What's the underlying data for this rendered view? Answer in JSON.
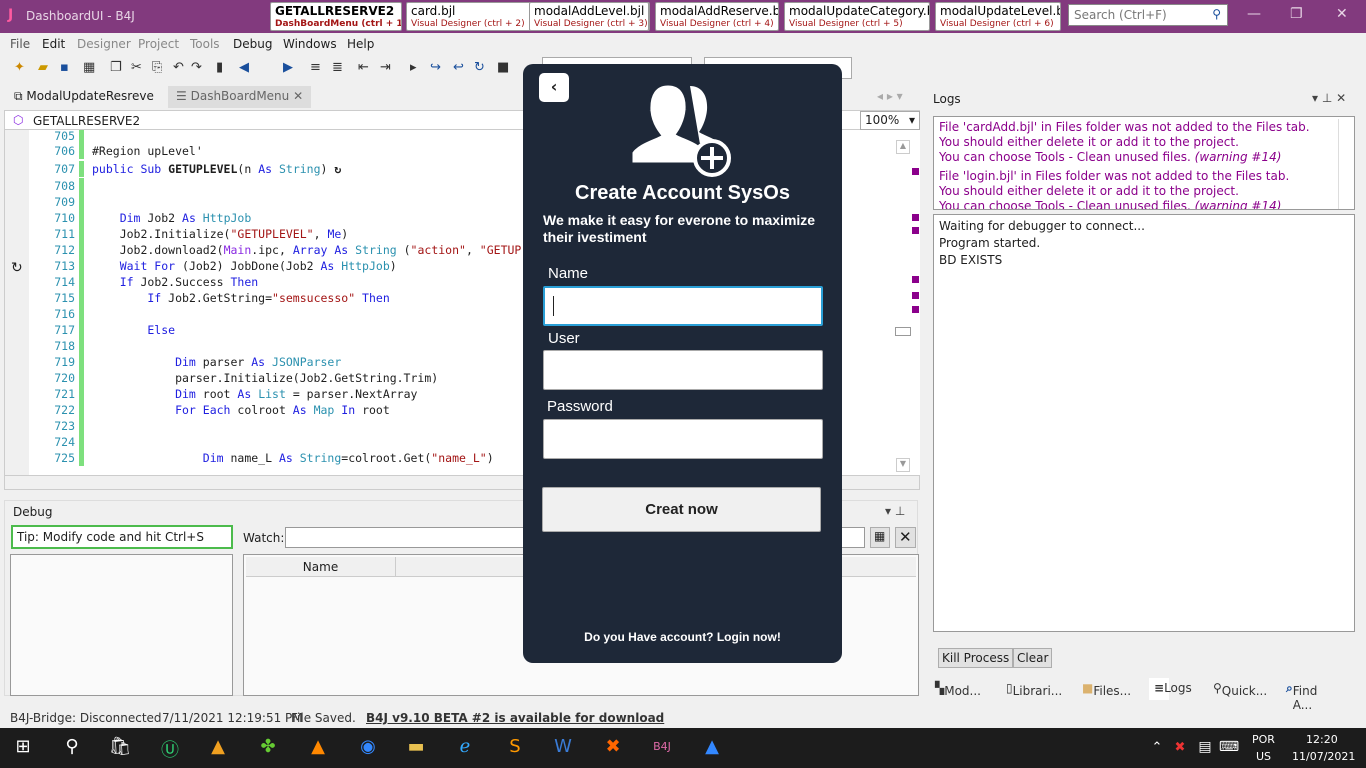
{
  "window": {
    "logo": "J",
    "title": "DashboardUI - B4J",
    "minimize": "—",
    "maximize": "❐",
    "close": "✕"
  },
  "file_tabs": [
    {
      "name": "GETALLRESERVE2",
      "sub": "DashBoardMenu  (ctrl + 1)"
    },
    {
      "name": "card.bjl",
      "sub": "Visual Designer  (ctrl + 2)"
    },
    {
      "name": "modalAddLevel.bjl",
      "sub": "Visual Designer  (ctrl + 3)"
    },
    {
      "name": "modalAddReserve.bjl",
      "sub": "Visual Designer  (ctrl + 4)"
    },
    {
      "name": "modalUpdateCategory.bjl",
      "sub": "Visual Designer  (ctrl + 5)"
    },
    {
      "name": "modalUpdateLevel.bjl",
      "sub": "Visual Designer  (ctrl + 6)"
    }
  ],
  "search": {
    "placeholder": "Search (Ctrl+F)",
    "icon": "search-icon"
  },
  "menu": [
    "File",
    "Edit",
    "Designer",
    "Project",
    "Tools",
    "Debug",
    "Windows",
    "Help"
  ],
  "doc_tabs": [
    "ModalUpdateResreve",
    "DashBoardMenu"
  ],
  "code_header": {
    "sub": "GETALLRESERVE2",
    "zoom": "100%"
  },
  "code_lines": [
    {
      "num": "705",
      "tokens": []
    },
    {
      "num": "706",
      "tokens": [
        {
          "t": "#Region upLevel'",
          "c": ""
        }
      ]
    },
    {
      "num": "707",
      "tokens": [
        {
          "t": "public Sub ",
          "c": "k"
        },
        {
          "t": "GETUPLEVEL",
          "c": "b"
        },
        {
          "t": "(n ",
          "c": ""
        },
        {
          "t": "As ",
          "c": "k"
        },
        {
          "t": "String",
          "c": "t"
        },
        {
          "t": ")",
          "c": ""
        }
      ]
    },
    {
      "num": "708",
      "tokens": []
    },
    {
      "num": "709",
      "tokens": []
    },
    {
      "num": "710",
      "tokens": [
        {
          "t": "    Dim ",
          "c": "k"
        },
        {
          "t": "Job2 ",
          "c": ""
        },
        {
          "t": "As ",
          "c": "k"
        },
        {
          "t": "HttpJob",
          "c": "t"
        }
      ]
    },
    {
      "num": "711",
      "tokens": [
        {
          "t": "    Job2.Initialize(",
          "c": ""
        },
        {
          "t": "\"GETUPLEVEL\"",
          "c": "s"
        },
        {
          "t": ", ",
          "c": ""
        },
        {
          "t": "Me",
          "c": "k"
        },
        {
          "t": ")",
          "c": ""
        }
      ]
    },
    {
      "num": "712",
      "tokens": [
        {
          "t": "    Job2.download2(",
          "c": ""
        },
        {
          "t": "Main",
          "c": "p"
        },
        {
          "t": ".ipc, ",
          "c": ""
        },
        {
          "t": "Array ",
          "c": "k"
        },
        {
          "t": "As ",
          "c": "k"
        },
        {
          "t": "String ",
          "c": "t"
        },
        {
          "t": "(",
          "c": ""
        },
        {
          "t": "\"action\"",
          "c": "s"
        },
        {
          "t": ", ",
          "c": ""
        },
        {
          "t": "\"GETUP",
          "c": "s"
        }
      ]
    },
    {
      "num": "713",
      "tokens": [
        {
          "t": "    Wait For ",
          "c": "k"
        },
        {
          "t": "(Job2) JobDone(Job2 ",
          "c": ""
        },
        {
          "t": "As ",
          "c": "k"
        },
        {
          "t": "HttpJob",
          "c": "t"
        },
        {
          "t": ")",
          "c": ""
        }
      ]
    },
    {
      "num": "714",
      "tokens": [
        {
          "t": "    If ",
          "c": "k"
        },
        {
          "t": "Job2.Success ",
          "c": ""
        },
        {
          "t": "Then",
          "c": "k"
        }
      ]
    },
    {
      "num": "715",
      "tokens": [
        {
          "t": "        If ",
          "c": "k"
        },
        {
          "t": "Job2.GetString=",
          "c": ""
        },
        {
          "t": "\"semsucesso\" ",
          "c": "s"
        },
        {
          "t": "Then",
          "c": "k"
        }
      ]
    },
    {
      "num": "716",
      "tokens": []
    },
    {
      "num": "717",
      "tokens": [
        {
          "t": "        Else",
          "c": "k"
        }
      ]
    },
    {
      "num": "718",
      "tokens": []
    },
    {
      "num": "719",
      "tokens": [
        {
          "t": "            Dim ",
          "c": "k"
        },
        {
          "t": "parser ",
          "c": ""
        },
        {
          "t": "As ",
          "c": "k"
        },
        {
          "t": "JSONParser",
          "c": "t"
        }
      ]
    },
    {
      "num": "720",
      "tokens": [
        {
          "t": "            parser.Initialize(Job2.GetString.Trim)",
          "c": ""
        }
      ]
    },
    {
      "num": "721",
      "tokens": [
        {
          "t": "            Dim ",
          "c": "k"
        },
        {
          "t": "root ",
          "c": ""
        },
        {
          "t": "As ",
          "c": "k"
        },
        {
          "t": "List ",
          "c": "t"
        },
        {
          "t": "= parser.NextArray",
          "c": ""
        }
      ]
    },
    {
      "num": "722",
      "tokens": [
        {
          "t": "            For Each ",
          "c": "k"
        },
        {
          "t": "colroot ",
          "c": ""
        },
        {
          "t": "As ",
          "c": "k"
        },
        {
          "t": "Map ",
          "c": "t"
        },
        {
          "t": "In ",
          "c": "k"
        },
        {
          "t": "root",
          "c": ""
        }
      ]
    },
    {
      "num": "723",
      "tokens": []
    },
    {
      "num": "724",
      "tokens": []
    },
    {
      "num": "725",
      "tokens": [
        {
          "t": "                Dim ",
          "c": "k"
        },
        {
          "t": "name_L ",
          "c": ""
        },
        {
          "t": "As ",
          "c": "k"
        },
        {
          "t": "String",
          "c": "t"
        },
        {
          "t": "=colroot.Get(",
          "c": ""
        },
        {
          "t": "\"name_L\"",
          "c": "s"
        },
        {
          "t": ")",
          "c": ""
        }
      ]
    }
  ],
  "debug": {
    "title": "Debug",
    "tip": "Tip: Modify code and hit Ctrl+S",
    "watch_label": "Watch:",
    "watch_value": "",
    "vars_column": "Name"
  },
  "status": {
    "bridge": "B4J-Bridge: Disconnected",
    "saved_time": "7/11/2021 12:19:51 PM",
    "saved": "File Saved.",
    "update_link": "B4J v9.10 BETA #2 is available for download"
  },
  "logs": {
    "title": "Logs",
    "warnings": [
      {
        "lines": [
          "File 'cardAdd.bjl' in Files folder was not added to the Files tab.",
          "You should either delete it or add it to the project.",
          "You can choose Tools - Clean unused files. "
        ],
        "tag": "(warning #14)"
      },
      {
        "lines": [
          "File 'login.bjl' in Files folder was not added to the Files tab.",
          "You should either delete it or add it to the project.",
          "You can choose Tools - Clean unused files. "
        ],
        "tag": "(warning #14)"
      }
    ],
    "output": [
      "Waiting for debugger to connect...",
      "Program started.",
      "BD EXISTS"
    ],
    "kill_button": "Kill Process",
    "clear_button": "Clear"
  },
  "bottom_tabs": [
    "Mod...",
    "Librari...",
    "Files...",
    "Logs",
    "Quick...",
    "Find A..."
  ],
  "modal": {
    "title": "Create Account SysOs",
    "subtitle": "We make it easy for everone to maximize their ivestiment",
    "fields": [
      {
        "label": "Name",
        "value": ""
      },
      {
        "label": "User",
        "value": ""
      },
      {
        "label": "Password",
        "value": ""
      }
    ],
    "submit": "Creat now",
    "login_link": "Do you Have account? Login now!",
    "back_icon": "chevron-left-icon",
    "header_icon": "add-users-icon"
  },
  "taskbar": {
    "lang": "POR",
    "layout": "US",
    "time": "12:20",
    "date": "11/07/2021"
  },
  "colors": {
    "titlebar": "#823a7e",
    "modal_bg": "#1e2838",
    "warning_text": "#8b008b",
    "tip_border": "#4cbb4c"
  }
}
